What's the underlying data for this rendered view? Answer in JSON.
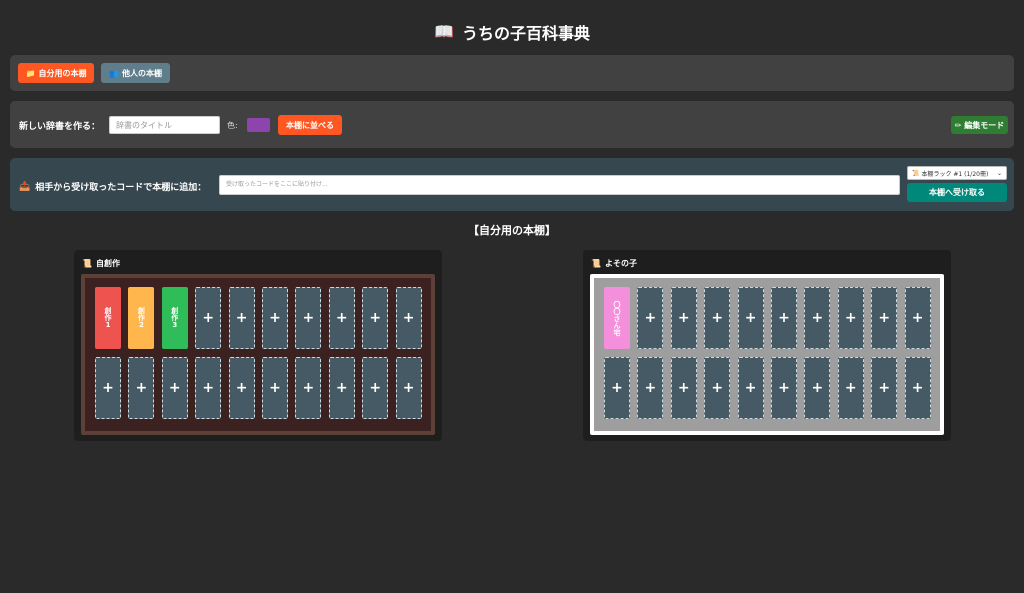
{
  "header": {
    "icon": "open-book-icon",
    "title": "うちの子百科事典"
  },
  "tabs": {
    "own": {
      "icon": "folder-icon",
      "label": "自分用の本棚",
      "color": "#ff5722"
    },
    "others": {
      "icon": "people-icon",
      "label": "他人の本棚",
      "color": "#607d8b"
    }
  },
  "create": {
    "label": "新しい辞書を作る：",
    "title_placeholder": "辞書のタイトル",
    "color_label": "色:",
    "color_value": "#8e44ad",
    "add_button": "本棚に並べる",
    "edit_button": "✏ 編集モード"
  },
  "receive": {
    "icon": "inbox-icon",
    "label": "相手から受け取ったコードで本棚に追加：",
    "code_placeholder": "受け取ったコードをここに貼り付け...",
    "rack_select": "本棚ラック #1 (1/20冊)",
    "receive_button": "本棚へ受け取る"
  },
  "section_heading": "【自分用の本棚】",
  "shelves": [
    {
      "title": "自創作",
      "icon": "scroll-icon",
      "rows": [
        [
          {
            "type": "book",
            "title": "創作1",
            "color": "#ef5350"
          },
          {
            "type": "book",
            "title": "創作2",
            "color": "#ffb74d"
          },
          {
            "type": "book",
            "title": "創作3",
            "color": "#2ebd59"
          },
          {
            "type": "empty",
            "label": "+"
          },
          {
            "type": "empty",
            "label": "+"
          },
          {
            "type": "empty",
            "label": "+"
          },
          {
            "type": "empty",
            "label": "+"
          },
          {
            "type": "empty",
            "label": "+"
          },
          {
            "type": "empty",
            "label": "+"
          },
          {
            "type": "empty",
            "label": "+"
          }
        ],
        [
          {
            "type": "empty",
            "label": "+"
          },
          {
            "type": "empty",
            "label": "+"
          },
          {
            "type": "empty",
            "label": "+"
          },
          {
            "type": "empty",
            "label": "+"
          },
          {
            "type": "empty",
            "label": "+"
          },
          {
            "type": "empty",
            "label": "+"
          },
          {
            "type": "empty",
            "label": "+"
          },
          {
            "type": "empty",
            "label": "+"
          },
          {
            "type": "empty",
            "label": "+"
          },
          {
            "type": "empty",
            "label": "+"
          }
        ]
      ]
    },
    {
      "title": "よその子",
      "icon": "scroll-icon",
      "rows": [
        [
          {
            "type": "book",
            "title": "〇〇さん宅",
            "color": "#f48fdb"
          },
          {
            "type": "empty",
            "label": "+"
          },
          {
            "type": "empty",
            "label": "+"
          },
          {
            "type": "empty",
            "label": "+"
          },
          {
            "type": "empty",
            "label": "+"
          },
          {
            "type": "empty",
            "label": "+"
          },
          {
            "type": "empty",
            "label": "+"
          },
          {
            "type": "empty",
            "label": "+"
          },
          {
            "type": "empty",
            "label": "+"
          },
          {
            "type": "empty",
            "label": "+"
          }
        ],
        [
          {
            "type": "empty",
            "label": "+"
          },
          {
            "type": "empty",
            "label": "+"
          },
          {
            "type": "empty",
            "label": "+"
          },
          {
            "type": "empty",
            "label": "+"
          },
          {
            "type": "empty",
            "label": "+"
          },
          {
            "type": "empty",
            "label": "+"
          },
          {
            "type": "empty",
            "label": "+"
          },
          {
            "type": "empty",
            "label": "+"
          },
          {
            "type": "empty",
            "label": "+"
          },
          {
            "type": "empty",
            "label": "+"
          }
        ]
      ]
    }
  ]
}
